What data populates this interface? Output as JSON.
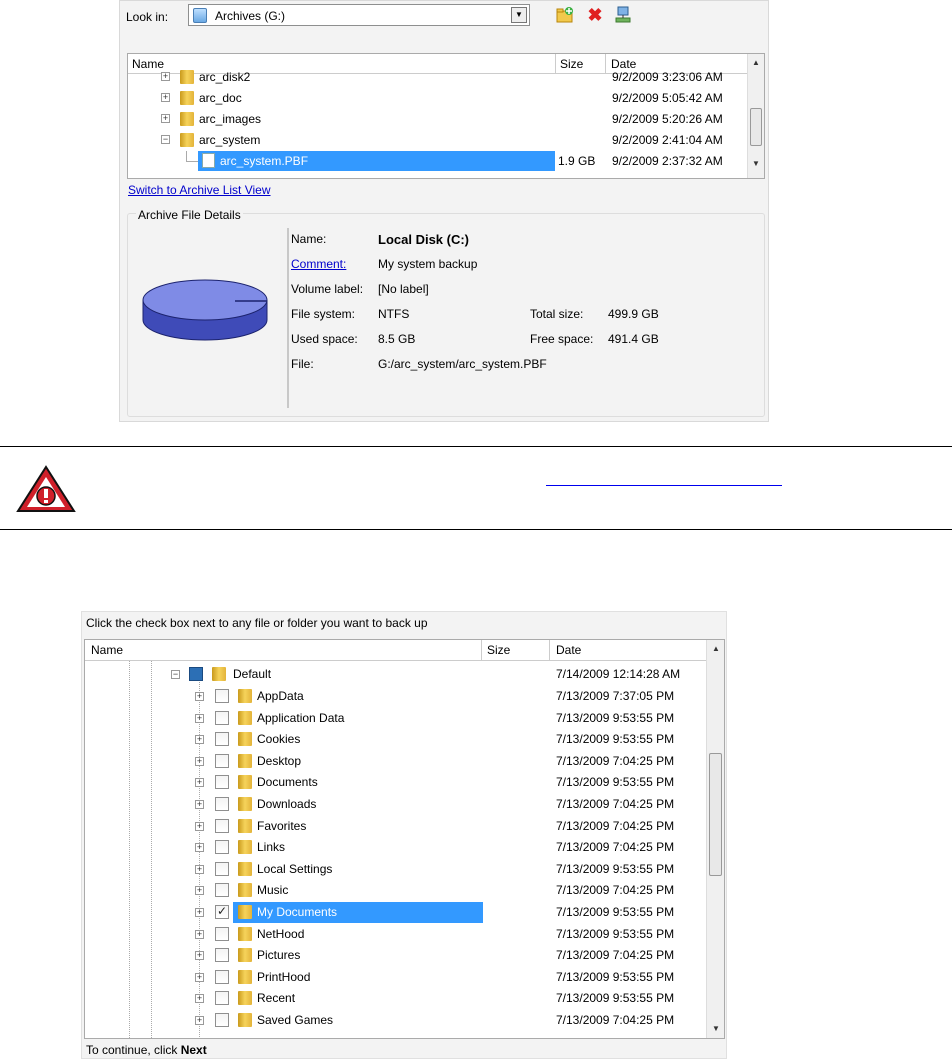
{
  "archive_dialog": {
    "look_in_label": "Look in:",
    "look_in_value": "Archives (G:)",
    "columns": {
      "name": "Name",
      "size": "Size",
      "date": "Date"
    },
    "rows": [
      {
        "name": "arc_disk2",
        "size": "",
        "date": "9/2/2009 3:23:06 AM",
        "expander": "+"
      },
      {
        "name": "arc_doc",
        "size": "",
        "date": "9/2/2009 5:05:42 AM",
        "expander": "+"
      },
      {
        "name": "arc_images",
        "size": "",
        "date": "9/2/2009 5:20:26 AM",
        "expander": "+"
      },
      {
        "name": "arc_system",
        "size": "",
        "date": "9/2/2009 2:41:04 AM",
        "expander": "−"
      },
      {
        "name": "arc_system.PBF",
        "size": "1.9 GB",
        "date": "9/2/2009 2:37:32 AM",
        "selected": true
      }
    ],
    "switch_link": "Switch to Archive List View",
    "details_legend": "Archive File Details",
    "details": {
      "name_label": "Name:",
      "name_value": "Local Disk (C:)",
      "comment_label": "Comment:",
      "comment_value": "My system backup",
      "volume_label": "Volume label:",
      "volume_value": "[No label]",
      "fs_label": "File system:",
      "fs_value": "NTFS",
      "total_label": "Total size:",
      "total_value": "499.9 GB",
      "used_label": "Used space:",
      "used_value": "8.5 GB",
      "free_label": "Free space:",
      "free_value": "491.4 GB",
      "file_label": "File:",
      "file_value": "G:/arc_system/arc_system.PBF"
    }
  },
  "backup_dialog": {
    "instruction": "Click the check box next to any file or folder you want to back up",
    "columns": {
      "name": "Name",
      "size": "Size",
      "date": "Date"
    },
    "root": {
      "name": "Default",
      "date": "7/14/2009 12:14:28 AM"
    },
    "items": [
      {
        "name": "AppData",
        "date": "7/13/2009 7:37:05 PM",
        "checked": false
      },
      {
        "name": "Application Data",
        "date": "7/13/2009 9:53:55 PM",
        "checked": false
      },
      {
        "name": "Cookies",
        "date": "7/13/2009 9:53:55 PM",
        "checked": false
      },
      {
        "name": "Desktop",
        "date": "7/13/2009 7:04:25 PM",
        "checked": false
      },
      {
        "name": "Documents",
        "date": "7/13/2009 9:53:55 PM",
        "checked": false
      },
      {
        "name": "Downloads",
        "date": "7/13/2009 7:04:25 PM",
        "checked": false
      },
      {
        "name": "Favorites",
        "date": "7/13/2009 7:04:25 PM",
        "checked": false
      },
      {
        "name": "Links",
        "date": "7/13/2009 7:04:25 PM",
        "checked": false
      },
      {
        "name": "Local Settings",
        "date": "7/13/2009 9:53:55 PM",
        "checked": false
      },
      {
        "name": "Music",
        "date": "7/13/2009 7:04:25 PM",
        "checked": false
      },
      {
        "name": "My Documents",
        "date": "7/13/2009 9:53:55 PM",
        "checked": true,
        "selected": true
      },
      {
        "name": "NetHood",
        "date": "7/13/2009 9:53:55 PM",
        "checked": false
      },
      {
        "name": "Pictures",
        "date": "7/13/2009 7:04:25 PM",
        "checked": false
      },
      {
        "name": "PrintHood",
        "date": "7/13/2009 9:53:55 PM",
        "checked": false
      },
      {
        "name": "Recent",
        "date": "7/13/2009 9:53:55 PM",
        "checked": false
      },
      {
        "name": "Saved Games",
        "date": "7/13/2009 7:04:25 PM",
        "checked": false
      }
    ],
    "continue_text": "To continue, click ",
    "continue_bold": "Next"
  },
  "colors": {
    "selection": "#3399ff",
    "link": "#0000cc",
    "warning_red": "#d0202a"
  }
}
